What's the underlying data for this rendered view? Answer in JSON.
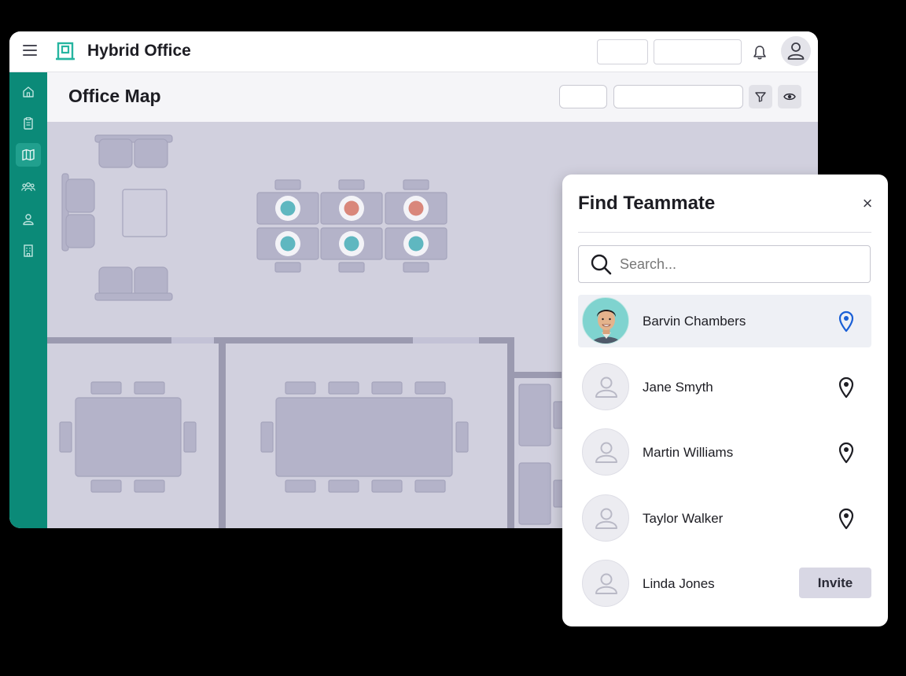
{
  "app": {
    "title": "Hybrid Office",
    "accent_color": "#0b8a78",
    "icons": [
      "menu-icon",
      "office-logo-icon",
      "bell-icon",
      "user-avatar-icon"
    ]
  },
  "sidebar": {
    "items": [
      {
        "name": "home",
        "icon": "home-icon",
        "active": false
      },
      {
        "name": "bookings",
        "icon": "clipboard-icon",
        "active": false
      },
      {
        "name": "map",
        "icon": "map-icon",
        "active": true
      },
      {
        "name": "teams",
        "icon": "group-icon",
        "active": false
      },
      {
        "name": "profile",
        "icon": "person-icon",
        "active": false
      },
      {
        "name": "buildings",
        "icon": "building-icon",
        "active": false
      }
    ]
  },
  "page": {
    "title": "Office Map",
    "icons": [
      "filter-icon",
      "eye-icon"
    ]
  },
  "map": {
    "desk_status_colors": {
      "available": "#5fb7c0",
      "occupied": "#d9877b"
    },
    "desk_rows": [
      [
        "available",
        "occupied",
        "occupied"
      ],
      [
        "available",
        "available",
        "available"
      ]
    ]
  },
  "find_teammate": {
    "title": "Find Teammate",
    "close_label": "×",
    "search_placeholder": "Search...",
    "people": [
      {
        "name": "Barvin Chambers",
        "has_photo": true,
        "action": "locate",
        "selected": true,
        "pin_color": "#1a5fd6"
      },
      {
        "name": "Jane Smyth",
        "has_photo": false,
        "action": "locate",
        "selected": false,
        "pin_color": "#1d1d23"
      },
      {
        "name": "Martin Williams",
        "has_photo": false,
        "action": "locate",
        "selected": false,
        "pin_color": "#1d1d23"
      },
      {
        "name": "Taylor Walker",
        "has_photo": false,
        "action": "locate",
        "selected": false,
        "pin_color": "#1d1d23"
      },
      {
        "name": "Linda Jones",
        "has_photo": false,
        "action": "invite",
        "selected": false,
        "action_label": "Invite"
      }
    ]
  }
}
